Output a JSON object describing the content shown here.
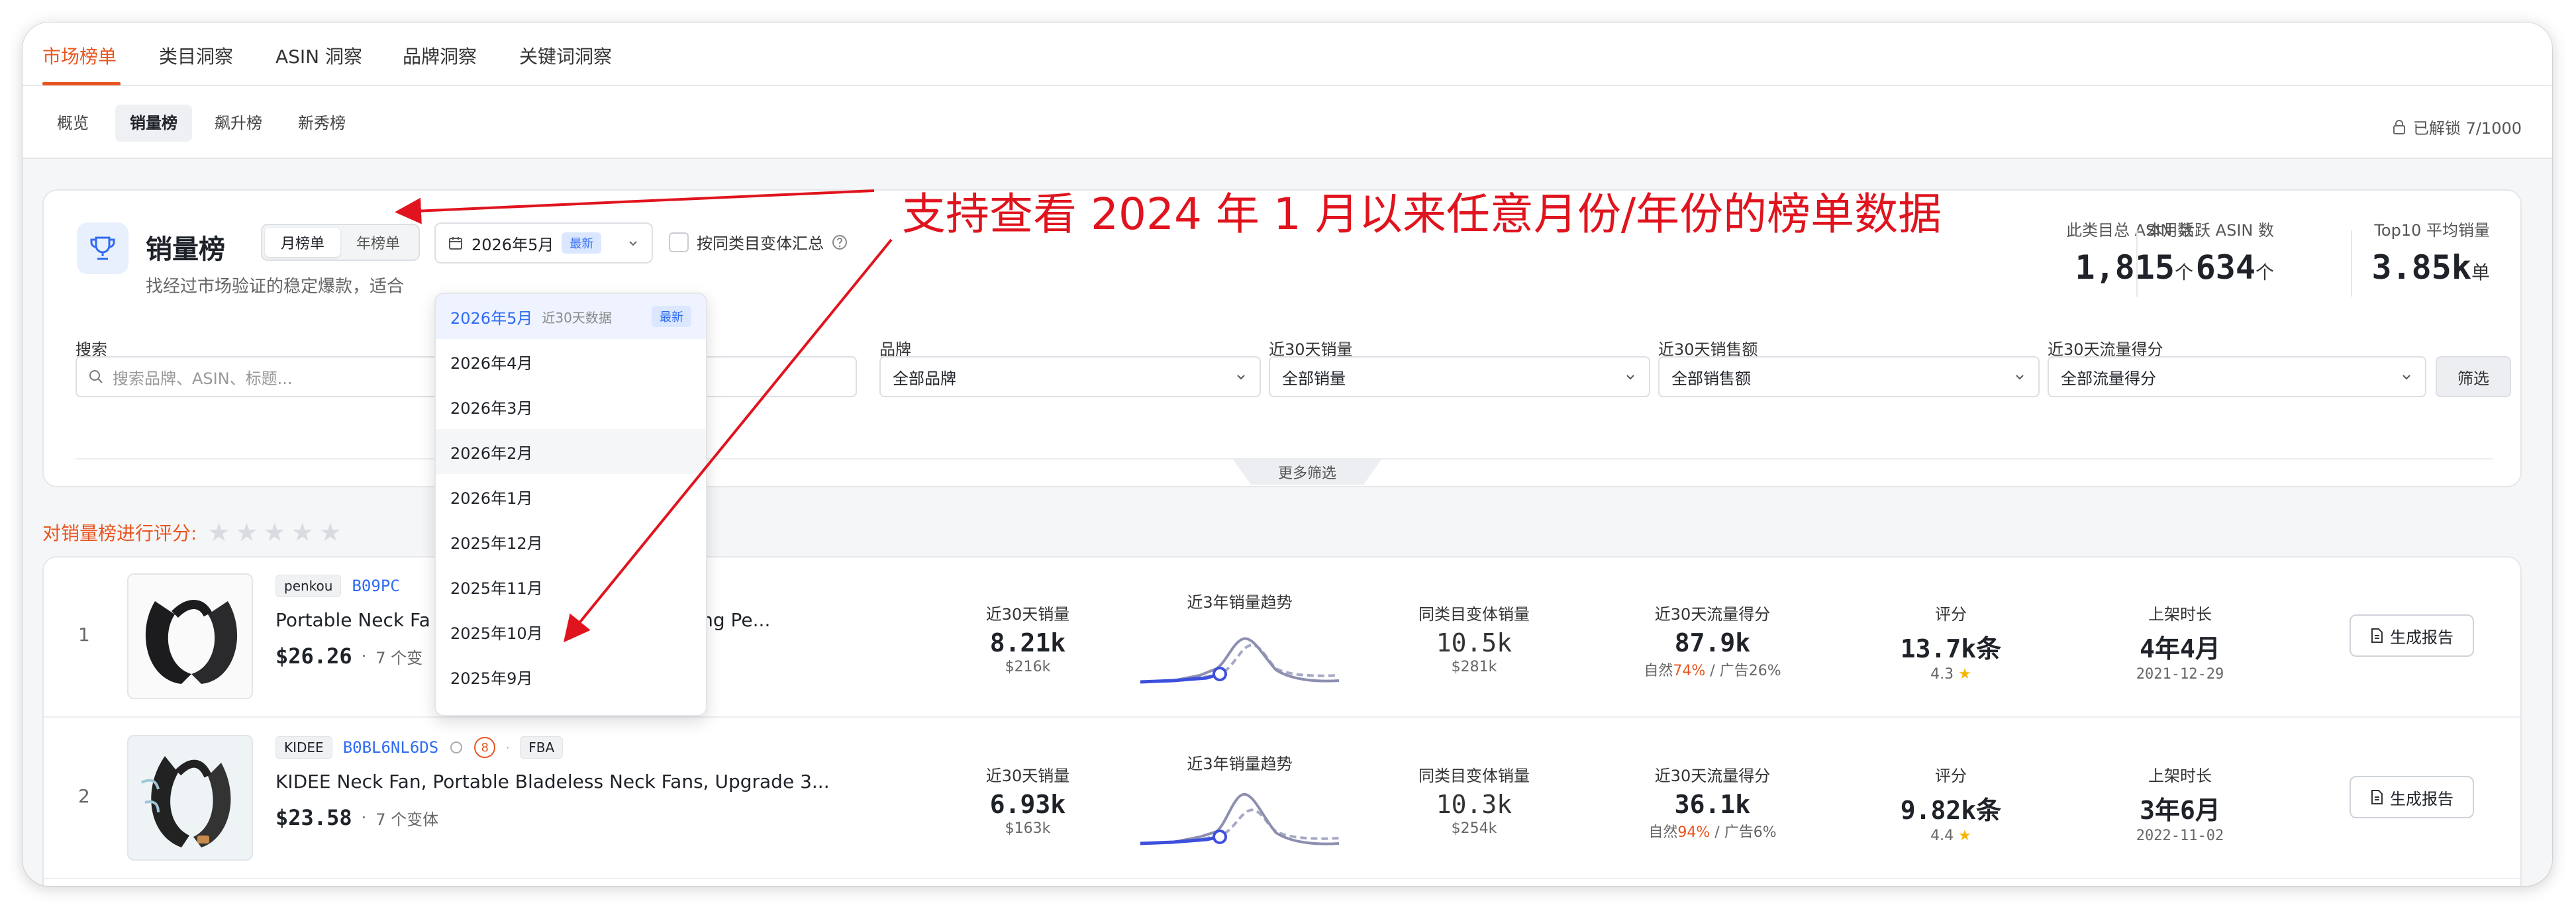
{
  "topnav": {
    "tabs": [
      "市场榜单",
      "类目洞察",
      "ASIN 洞察",
      "品牌洞察",
      "关键词洞察"
    ]
  },
  "subnav": {
    "tabs": [
      "概览",
      "销量榜",
      "飙升榜",
      "新秀榜"
    ],
    "unlock": "已解锁 7/1000"
  },
  "header": {
    "title": "销量榜",
    "subtitle": "找经过市场验证的稳定爆款，适合",
    "period_tabs": [
      "月榜单",
      "年榜单"
    ],
    "date_value": "2026年5月",
    "date_badge": "最新",
    "variant_checkbox": "按同类目变体汇总"
  },
  "stats": [
    {
      "label": "此类目总 ASIN 数",
      "value": "1,815",
      "unit": "个"
    },
    {
      "label": "本月活跃 ASIN 数",
      "value": "634",
      "unit": "个"
    },
    {
      "label": "Top10 平均销量",
      "value": "3.85k",
      "unit": "单"
    }
  ],
  "filters": {
    "search_label": "搜索",
    "search_placeholder": "搜索品牌、ASIN、标题...",
    "brand_label": "品牌",
    "brand_value": "全部品牌",
    "sales_label": "近30天销量",
    "sales_value": "全部销量",
    "revenue_label": "近30天销售额",
    "revenue_value": "全部销售额",
    "traffic_label": "近30天流量得分",
    "traffic_value": "全部流量得分",
    "filter_button": "筛选",
    "more_filters": "更多筛选"
  },
  "rating": {
    "label": "对销量榜进行评分:"
  },
  "dropdown": {
    "items": [
      {
        "label": "2026年5月",
        "hint": "近30天数据",
        "badge": "最新"
      },
      {
        "label": "2026年4月"
      },
      {
        "label": "2026年3月"
      },
      {
        "label": "2026年2月"
      },
      {
        "label": "2026年1月"
      },
      {
        "label": "2025年12月"
      },
      {
        "label": "2025年11月"
      },
      {
        "label": "2025年10月"
      },
      {
        "label": "2025年9月"
      }
    ]
  },
  "annotation": "支持查看 2024 年 1 月以来任意月份/年份的榜单数据",
  "products": [
    {
      "rank": "1",
      "brand": "penkou",
      "asin": "B09PC",
      "title": "Portable Neck Fa",
      "title_tail": "Cooling Pe...",
      "price": "$26.26",
      "variants": "7 个变",
      "sales_label": "近30天销量",
      "sales": "8.21k",
      "revenue": "$216k",
      "trend_label": "近3年销量趋势",
      "variant_sales_label": "同类目变体销量",
      "variant_sales": "10.5k",
      "variant_revenue": "$281k",
      "traffic_label": "近30天流量得分",
      "traffic": "87.9k",
      "organic_prefix": "自然",
      "organic": "74%",
      "ad": "/ 广告26%",
      "review_label": "评分",
      "reviews": "13.7k条",
      "score": "4.3",
      "listed_label": "上架时长",
      "listed": "4年4月",
      "listed_date": "2021-12-29",
      "report": "生成报告"
    },
    {
      "rank": "2",
      "brand": "KIDEE",
      "asin": "B0BL6NL6DS",
      "badge_num": "8",
      "fba": "FBA",
      "title": "KIDEE Neck Fan, Portable Bladeless Neck Fans, Upgrade 3...",
      "price": "$23.58",
      "variants": "7 个变体",
      "sales_label": "近30天销量",
      "sales": "6.93k",
      "revenue": "$163k",
      "trend_label": "近3年销量趋势",
      "variant_sales_label": "同类目变体销量",
      "variant_sales": "10.3k",
      "variant_revenue": "$254k",
      "traffic_label": "近30天流量得分",
      "traffic": "36.1k",
      "organic_prefix": "自然",
      "organic": "94%",
      "ad": "/ 广告6%",
      "review_label": "评分",
      "reviews": "9.82k条",
      "score": "4.4",
      "listed_label": "上架时长",
      "listed": "3年6月",
      "listed_date": "2022-11-02",
      "report": "生成报告"
    }
  ],
  "colors": {
    "accent": "#e8551f",
    "link": "#2f6bf2",
    "annotation": "#e0141e"
  }
}
